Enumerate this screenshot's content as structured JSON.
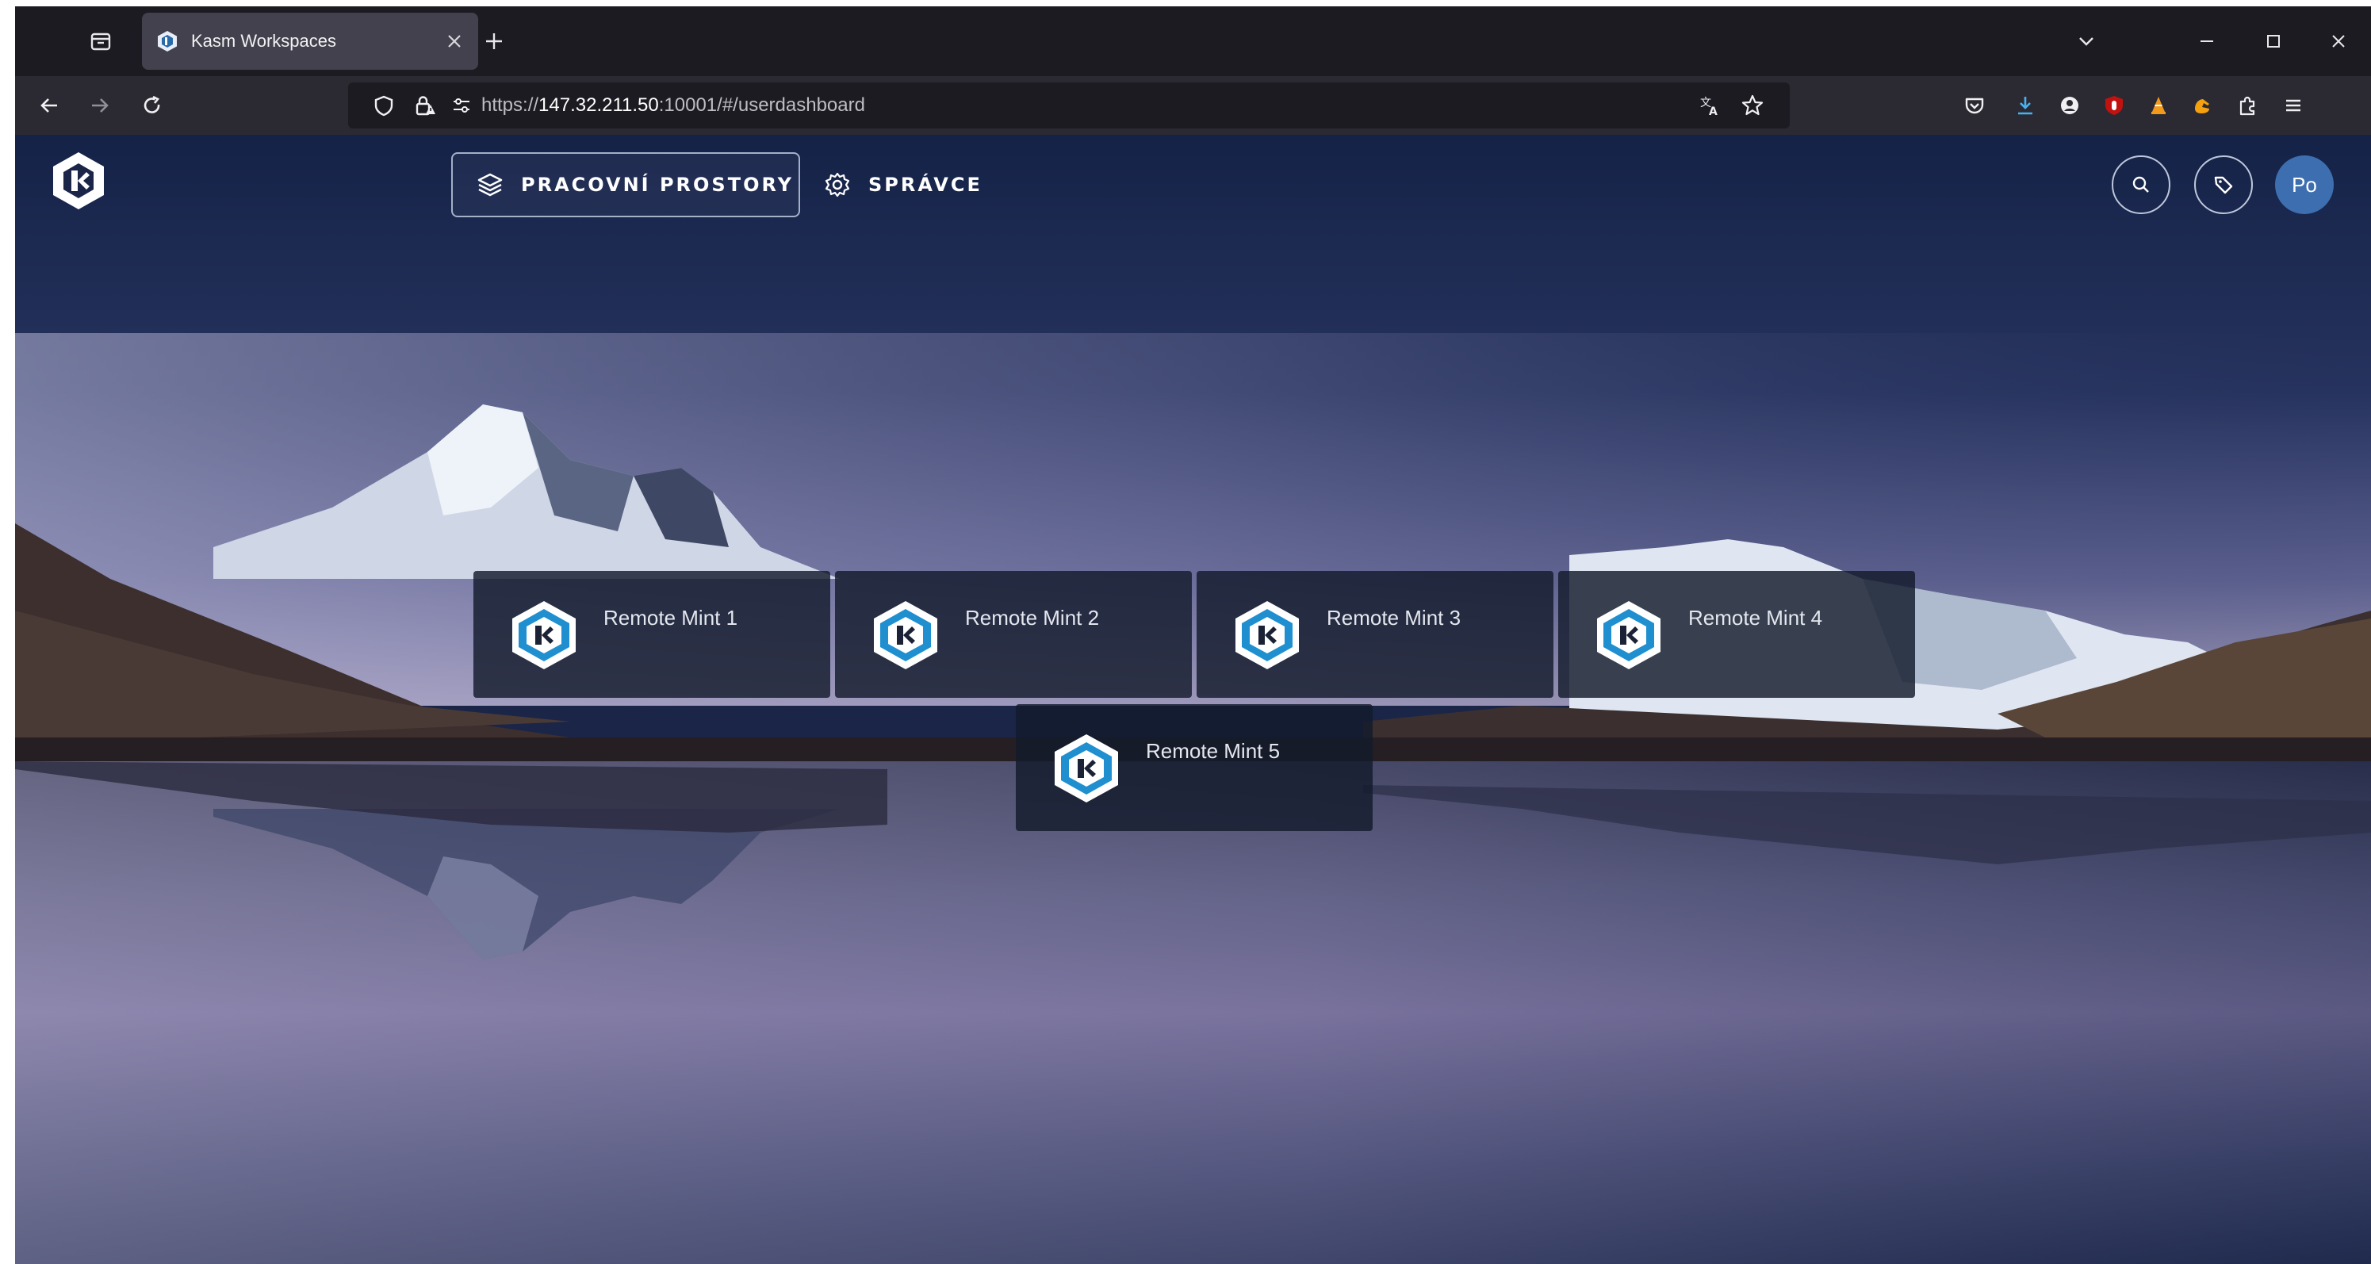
{
  "browser": {
    "tab": {
      "title": "Kasm Workspaces"
    },
    "url": {
      "prefix": "https://",
      "host": "147.32.211.50",
      "rest": ":10001/#/userdashboard"
    }
  },
  "header": {
    "nav": [
      {
        "label": "PRACOVNÍ PROSTORY",
        "icon": "layers-icon",
        "active": true
      },
      {
        "label": "SPRÁVCE",
        "icon": "gear-icon",
        "active": false
      }
    ],
    "avatar_initials": "Po"
  },
  "workspaces": [
    {
      "name": "Remote Mint 1"
    },
    {
      "name": "Remote Mint 2"
    },
    {
      "name": "Remote Mint 3"
    },
    {
      "name": "Remote Mint 4"
    },
    {
      "name": "Remote Mint 5"
    }
  ],
  "colors": {
    "accent": "#1f8fd0",
    "avatar": "#3d6fb0",
    "card_bg": "#141b2c"
  }
}
